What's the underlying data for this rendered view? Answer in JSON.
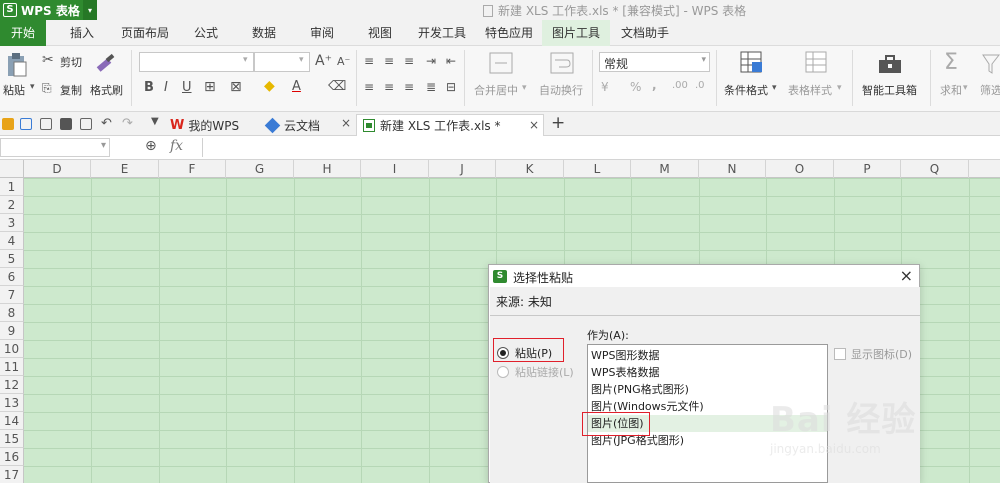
{
  "app": {
    "badge": "WPS 表格",
    "doc_title": "新建 XLS 工作表.xls * [兼容模式] - WPS 表格"
  },
  "tabs": [
    "开始",
    "插入",
    "页面布局",
    "公式",
    "数据",
    "审阅",
    "视图",
    "开发工具",
    "特色应用",
    "图片工具",
    "文档助手"
  ],
  "ribbon": {
    "paste": "粘贴",
    "cut": "剪切",
    "copy": "复制",
    "format_painter": "格式刷",
    "bold": "B",
    "italic": "I",
    "underline": "U",
    "merge_center": "合并居中",
    "auto_wrap": "自动换行",
    "number_format": "常规",
    "percent": "%",
    "comma": ",",
    "conditional_format": "条件格式",
    "table_style": "表格样式",
    "smart_toolbox": "智能工具箱",
    "sum": "求和",
    "filter": "筛选",
    "sum_glyph": "Σ"
  },
  "docbar": {
    "my_wps": "我的WPS",
    "cloud_docs": "云文档",
    "active_doc": "新建 XLS 工作表.xls *",
    "close": "×",
    "add": "+"
  },
  "formula_bar": {
    "fx": "fx"
  },
  "columns": [
    "D",
    "E",
    "F",
    "G",
    "H",
    "I",
    "J",
    "K",
    "L",
    "M",
    "N",
    "O",
    "P",
    "Q"
  ],
  "rows": [
    "1",
    "2",
    "3",
    "4",
    "5",
    "6",
    "7",
    "8",
    "9",
    "10",
    "11",
    "12",
    "13",
    "14",
    "15",
    "16",
    "17"
  ],
  "dialog": {
    "title": "选择性粘贴",
    "close": "×",
    "source": "来源: 未知",
    "paste_option": "粘贴(P)",
    "paste_link_option": "粘贴链接(L)",
    "as_label": "作为(A):",
    "items": [
      "WPS图形数据",
      "WPS表格数据",
      "图片(PNG格式图形)",
      "图片(Windows元文件)",
      "图片(位图)",
      "图片(JPG格式图形)"
    ],
    "selected_item": "图片(位图)",
    "show_icon": "显示图标(D)"
  },
  "watermark": {
    "brand": "Bai 经验",
    "url": "jingyan.baidu.com"
  },
  "colors": {
    "brand_green": "#2f8a2f",
    "sheet_bg": "#cde9cd",
    "highlight_red": "#e0202b"
  }
}
